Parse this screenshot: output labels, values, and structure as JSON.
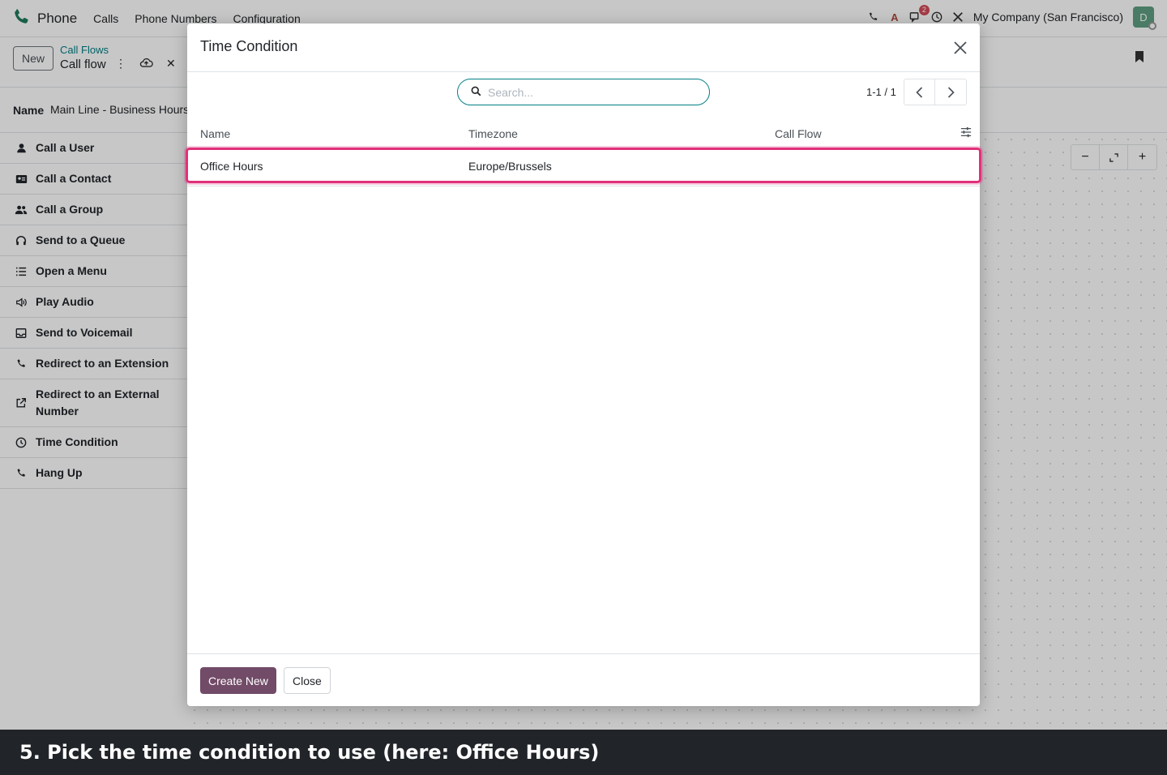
{
  "app": {
    "name": "Phone",
    "menu": [
      "Calls",
      "Phone Numbers",
      "Configuration"
    ],
    "company": "My Company (San Francisco)",
    "avatar_letter": "D",
    "chat_badge": "2",
    "brand_color": "#1f7a5a"
  },
  "control": {
    "new_label": "New",
    "breadcrumb_parent": "Call Flows",
    "breadcrumb_current": "Call flow"
  },
  "record": {
    "name_label": "Name",
    "name_value": "Main Line - Business Hours"
  },
  "sidebar": {
    "items": [
      {
        "label": "Call a User",
        "icon": "user-icon"
      },
      {
        "label": "Call a Contact",
        "icon": "contact-card-icon"
      },
      {
        "label": "Call a Group",
        "icon": "group-icon"
      },
      {
        "label": "Send to a Queue",
        "icon": "headset-icon"
      },
      {
        "label": "Open a Menu",
        "icon": "list-icon"
      },
      {
        "label": "Play Audio",
        "icon": "speaker-icon"
      },
      {
        "label": "Send to Voicemail",
        "icon": "inbox-icon"
      },
      {
        "label": "Redirect to an Extension",
        "icon": "phone-icon"
      },
      {
        "label": "Redirect to an External Number",
        "icon": "external-link-icon"
      },
      {
        "label": "Time Condition",
        "icon": "clock-icon"
      },
      {
        "label": "Hang Up",
        "icon": "phone-hangup-icon"
      }
    ]
  },
  "modal": {
    "title": "Time Condition",
    "search_placeholder": "Search...",
    "pager": "1-1 / 1",
    "columns": [
      "Name",
      "Timezone",
      "Call Flow"
    ],
    "rows": [
      {
        "name": "Office Hours",
        "timezone": "Europe/Brussels",
        "call_flow": ""
      }
    ],
    "create_label": "Create New",
    "close_label": "Close",
    "primary_color": "#714b67",
    "highlight_color": "#e0307a"
  },
  "caption": "5. Pick the time condition to use (here: Office Hours)"
}
